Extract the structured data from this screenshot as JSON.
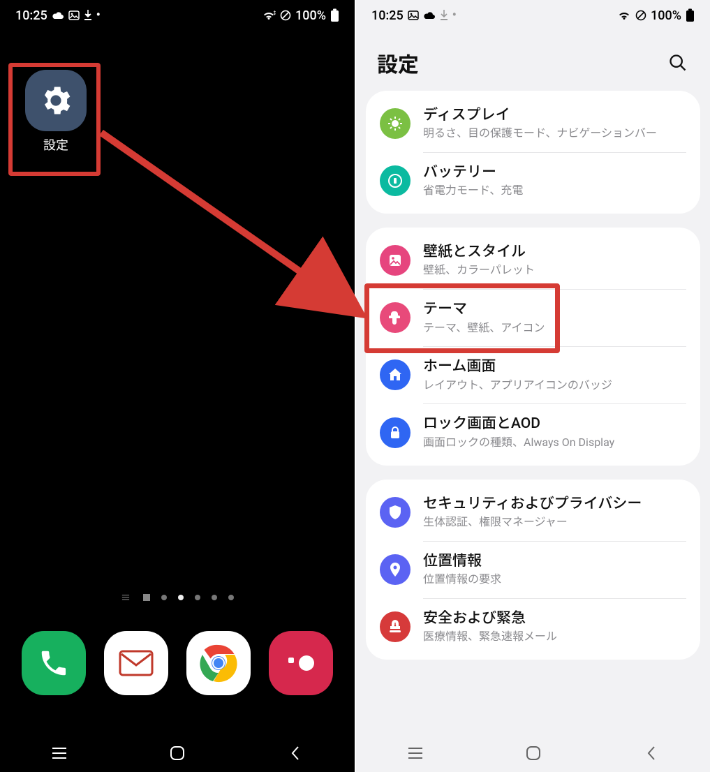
{
  "left": {
    "statusbar": {
      "time": "10:25",
      "battery": "100%"
    },
    "app": {
      "label": "設定"
    },
    "pager": {
      "total": 7,
      "active_index": 3
    }
  },
  "right": {
    "statusbar": {
      "time": "10:25",
      "battery": "100%"
    },
    "header": {
      "title": "設定"
    },
    "groups": [
      {
        "items": [
          {
            "icon": "display-icon",
            "color": "#7bc043",
            "title": "ディスプレイ",
            "sub": "明るさ、目の保護モード、ナビゲーションバー"
          },
          {
            "icon": "battery-icon",
            "color": "#0bbaa0",
            "title": "バッテリー",
            "sub": "省電力モード、充電"
          }
        ]
      },
      {
        "items": [
          {
            "icon": "wallpaper-icon",
            "color": "#e6457e",
            "title": "壁紙とスタイル",
            "sub": "壁紙、カラーパレット"
          },
          {
            "icon": "theme-icon",
            "color": "#e84a7a",
            "title": "テーマ",
            "sub": "テーマ、壁紙、アイコン",
            "highlight": true
          },
          {
            "icon": "home-icon",
            "color": "#2f66f3",
            "title": "ホーム画面",
            "sub": "レイアウト、アプリアイコンのバッジ"
          },
          {
            "icon": "lock-icon",
            "color": "#2f66f3",
            "title": "ロック画面とAOD",
            "sub": "画面ロックの種類、Always On Display"
          }
        ]
      },
      {
        "items": [
          {
            "icon": "shield-icon",
            "color": "#5b63f3",
            "title": "セキュリティおよびプライバシー",
            "sub": "生体認証、権限マネージャー"
          },
          {
            "icon": "location-icon",
            "color": "#5b63f3",
            "title": "位置情報",
            "sub": "位置情報の要求"
          },
          {
            "icon": "emergency-icon",
            "color": "#d63a3a",
            "title": "安全および緊急",
            "sub": "医療情報、緊急速報メール"
          }
        ]
      }
    ]
  }
}
